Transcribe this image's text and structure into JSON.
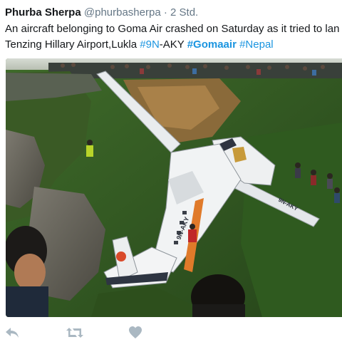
{
  "tweet": {
    "author_name": "Phurba Sherpa",
    "handle": "@phurbasherpa",
    "separator": "·",
    "time": "2 Std.",
    "text_line1": "An aircraft belonging to Goma Air crashed on Saturday as it tried to lan",
    "text_line2_plain": "Tenzing Hillary Airport,Lukla ",
    "hashtag_1": "#9N",
    "text_line2_after_link": "-AKY ",
    "hashtag_2": "#Gomaair",
    "hashtag_3": "#Nepal",
    "photo": {
      "aircraft_registration": "9N-AKY",
      "tail_mark": "9N-AKY"
    }
  },
  "actions": [
    {
      "name": "reply",
      "icon": "reply-icon"
    },
    {
      "name": "retweet",
      "icon": "retweet-icon"
    },
    {
      "name": "like",
      "icon": "heart-icon"
    }
  ],
  "colors": {
    "link": "#1b95e0",
    "meta": "#657786",
    "icon": "#aab8c2",
    "text": "#14171a"
  }
}
